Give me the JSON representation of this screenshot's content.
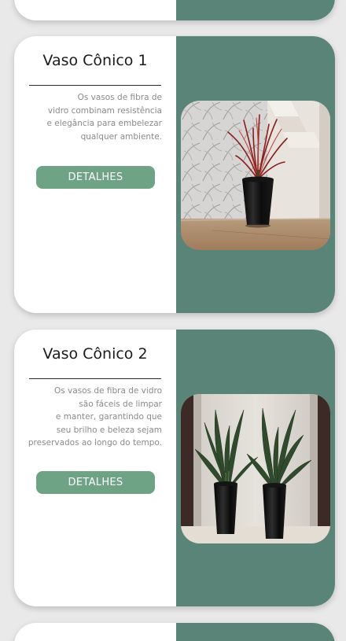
{
  "products": [
    {
      "title": "Vaso Cônico 1",
      "description": "Os vasos de fibra de\nvidro combinam resistência\ne elegância para embelezar\nqualquer ambiente.",
      "button_label": "DETALHES"
    },
    {
      "title": "Vaso Cônico 2",
      "description": "Os vasos de fibra de vidro\nsão fáceis de limpar\ne manter, garantindo que\nseu brilho e beleza sejam\npreservados ao longo do tempo.",
      "button_label": "DETALHES"
    }
  ],
  "colors": {
    "page_background": "#e9e9e9",
    "card_panel": "#5b8478",
    "button": "#6ea385",
    "button_text": "#ffffff",
    "title_text": "#1b1b1b",
    "description_text": "#8a8a8a"
  }
}
